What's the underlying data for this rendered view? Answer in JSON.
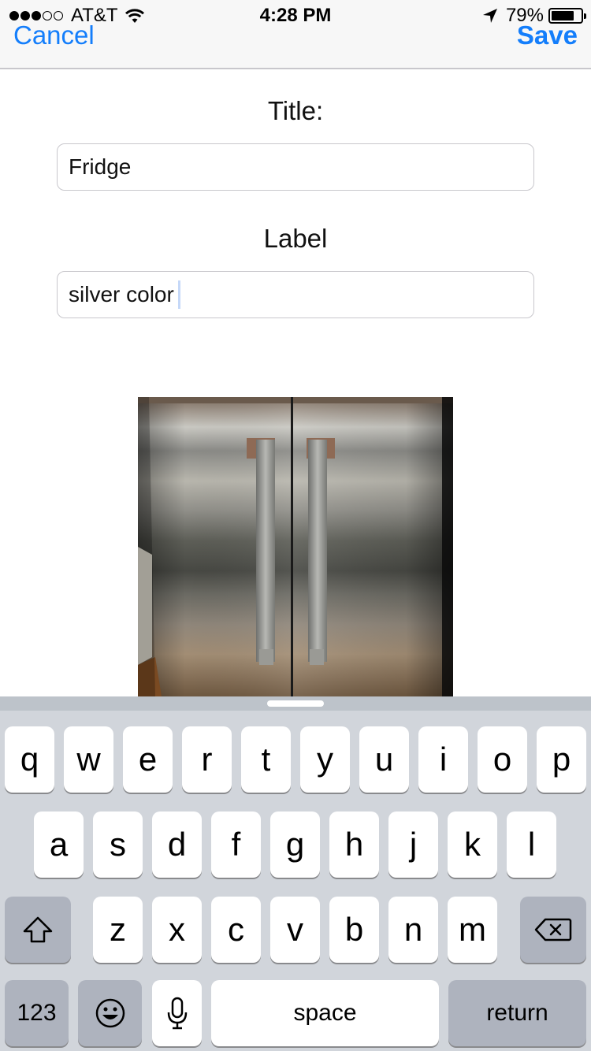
{
  "status_bar": {
    "carrier": "AT&T",
    "time": "4:28 PM",
    "battery_percent": "79%",
    "battery_level": 0.79,
    "signal_bars_filled": 3,
    "signal_bars_total": 5
  },
  "nav": {
    "cancel_label": "Cancel",
    "save_label": "Save"
  },
  "form": {
    "title_label": "Title:",
    "title_value": "Fridge",
    "label_label": "Label",
    "label_value": "silver color"
  },
  "photo": {
    "icon": "stainless-fridge-photo"
  },
  "keyboard": {
    "row1": [
      "q",
      "w",
      "e",
      "r",
      "t",
      "y",
      "u",
      "i",
      "o",
      "p"
    ],
    "row2": [
      "a",
      "s",
      "d",
      "f",
      "g",
      "h",
      "j",
      "k",
      "l"
    ],
    "row3": [
      "z",
      "x",
      "c",
      "v",
      "b",
      "n",
      "m"
    ],
    "numbers_label": "123",
    "space_label": "space",
    "return_label": "return"
  },
  "colors": {
    "accent": "#147efb",
    "keyboard_bg": "#d1d5db",
    "special_key": "#aeb3be"
  }
}
